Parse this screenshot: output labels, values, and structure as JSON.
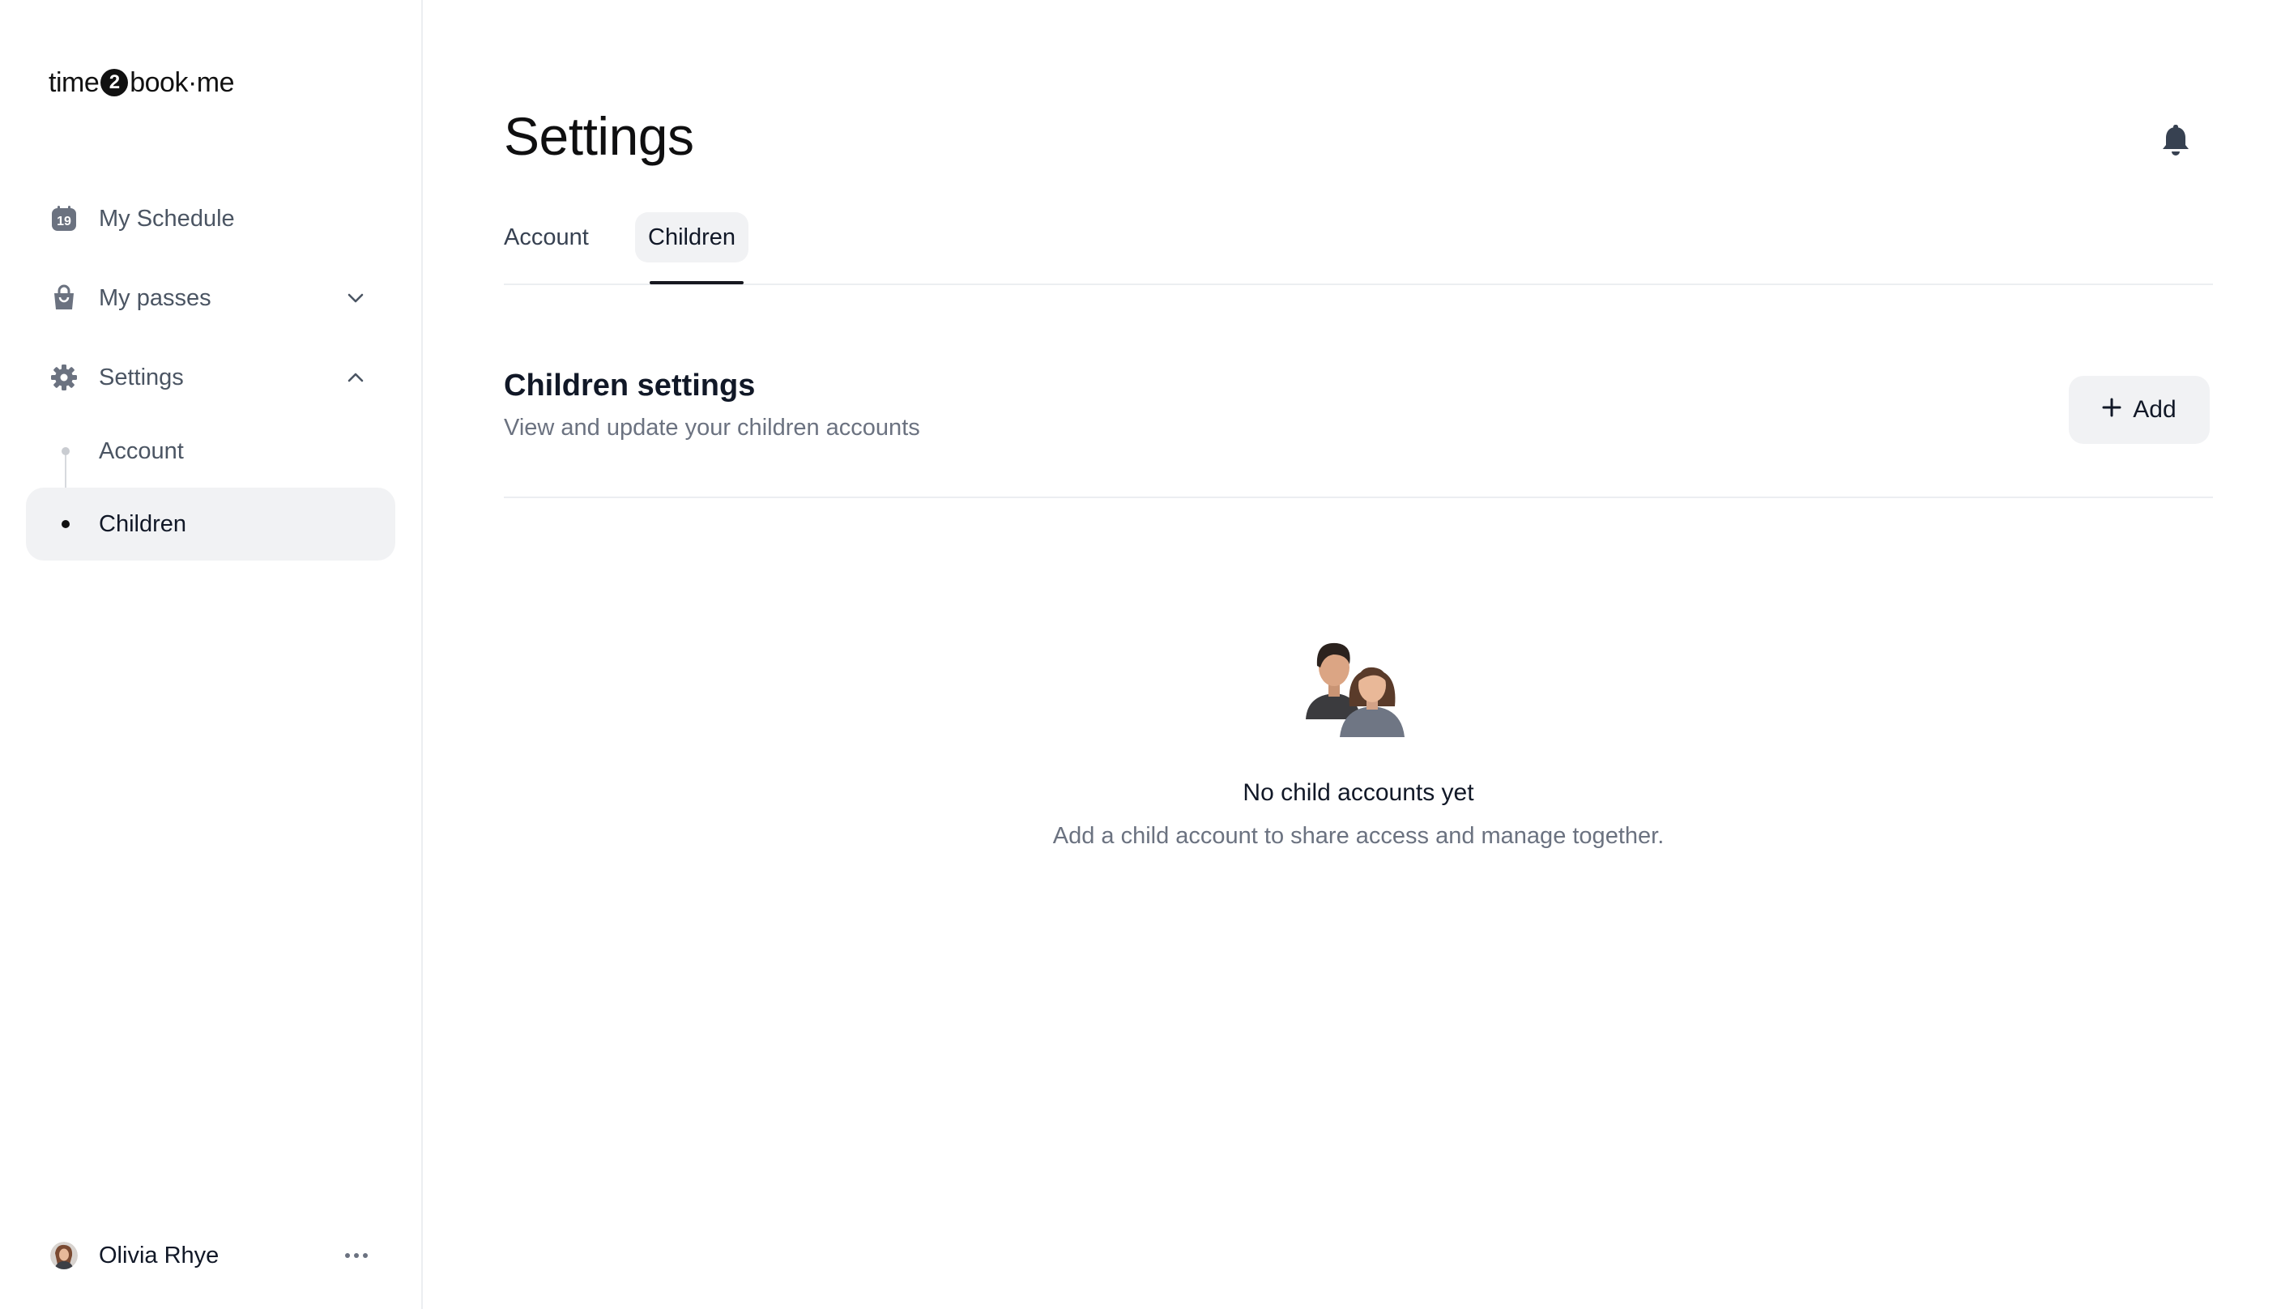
{
  "brand": {
    "logo_left": "time",
    "logo_mid": "2",
    "logo_right": "book·me"
  },
  "sidebar": {
    "items": [
      {
        "label": "My Schedule",
        "icon": "calendar-icon",
        "badge": "19"
      },
      {
        "label": "My passes",
        "icon": "shopping-bag-icon",
        "expanded": false
      },
      {
        "label": "Settings",
        "icon": "gear-icon",
        "expanded": true
      }
    ],
    "sub_items": [
      {
        "label": "Account",
        "active": false
      },
      {
        "label": "Children",
        "active": true
      }
    ]
  },
  "user": {
    "name": "Olivia Rhye"
  },
  "header": {
    "title": "Settings"
  },
  "tabs": [
    {
      "label": "Account",
      "active": false
    },
    {
      "label": "Children",
      "active": true
    }
  ],
  "section": {
    "title": "Children settings",
    "subtitle": "View and update your children accounts",
    "add_label": "Add"
  },
  "empty_state": {
    "title": "No child accounts yet",
    "subtitle": "Add a child account to share access and manage together."
  }
}
